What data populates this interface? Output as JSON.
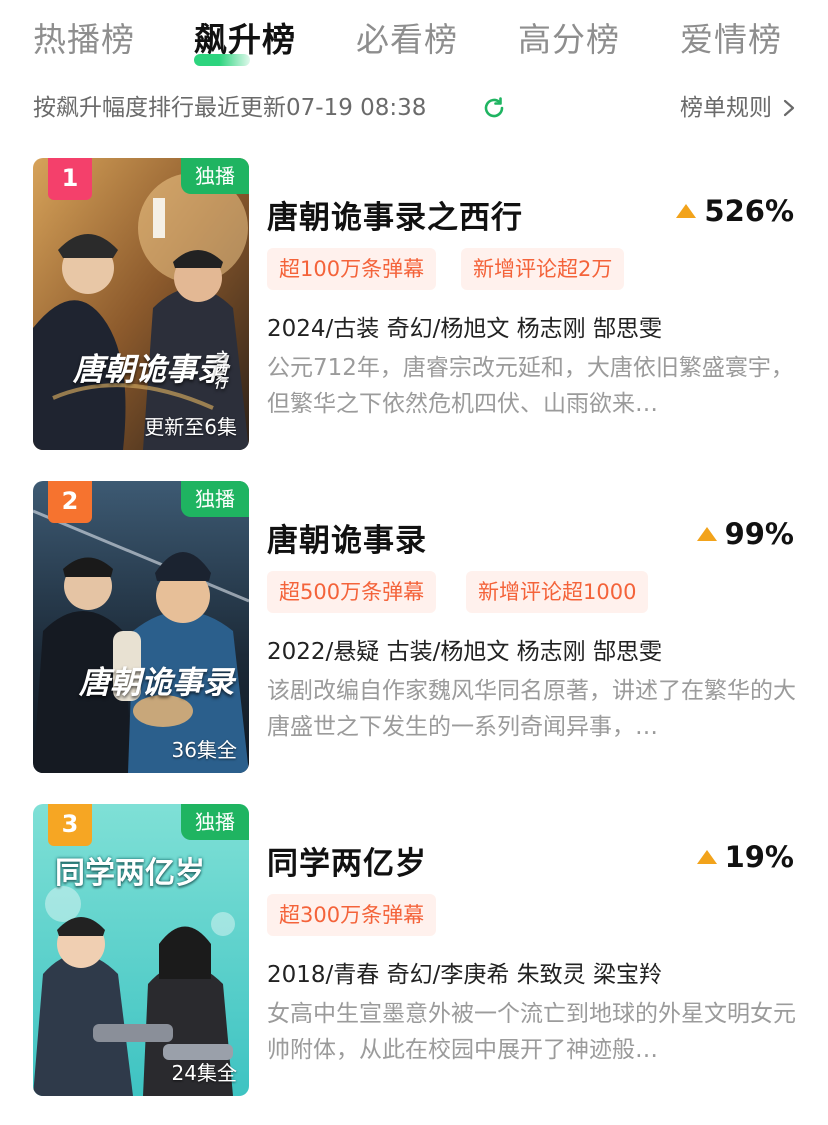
{
  "tabs": [
    "热播榜",
    "飙升榜",
    "必看榜",
    "高分榜",
    "爱情榜"
  ],
  "subheader": {
    "text": "按飙升幅度排行最近更新07-19 08:38",
    "rules_label": "榜单规则"
  },
  "items": [
    {
      "rank": "1",
      "badge": "独播",
      "episode_status": "更新至6集",
      "poster_title": "唐朝诡事录",
      "poster_subtitle": "之西行",
      "title": "唐朝诡事录之西行",
      "trend": "526%",
      "tags": [
        "超100万条弹幕",
        "新增评论超2万"
      ],
      "meta": "2024/古装 奇幻/杨旭文 杨志刚 郜思雯",
      "description": "公元712年，唐睿宗改元延和，大唐依旧繁盛寰宇，但繁华之下依然危机四伏、山雨欲来…"
    },
    {
      "rank": "2",
      "badge": "独播",
      "episode_status": "36集全",
      "poster_title": "唐朝诡事录",
      "title": "唐朝诡事录",
      "trend": "99%",
      "tags": [
        "超500万条弹幕",
        "新增评论超1000"
      ],
      "meta": "2022/悬疑 古装/杨旭文 杨志刚 郜思雯",
      "description": "该剧改编自作家魏风华同名原著，讲述了在繁华的大唐盛世之下发生的一系列奇闻异事，…"
    },
    {
      "rank": "3",
      "badge": "独播",
      "episode_status": "24集全",
      "poster_title": "同学两亿岁",
      "title": "同学两亿岁",
      "trend": "19%",
      "tags": [
        "超300万条弹幕"
      ],
      "meta": "2018/青春 奇幻/李庚希 朱致灵 梁宝羚",
      "description": "女高中生宣墨意外被一个流亡到地球的外星文明女元帅附体，从此在校园中展开了神迹般…"
    }
  ],
  "colors": {
    "accent_green": "#2dd47e",
    "badge_green": "#1fb461",
    "tag_bg": "#fff1ed",
    "tag_text": "#f4633a",
    "trend_up": "#f2a31b",
    "rank1": "#f4406b",
    "rank2": "#f6732f",
    "rank3": "#f6a623"
  },
  "icons": [
    "refresh-icon",
    "chevron-right-icon",
    "trend-up-icon"
  ]
}
